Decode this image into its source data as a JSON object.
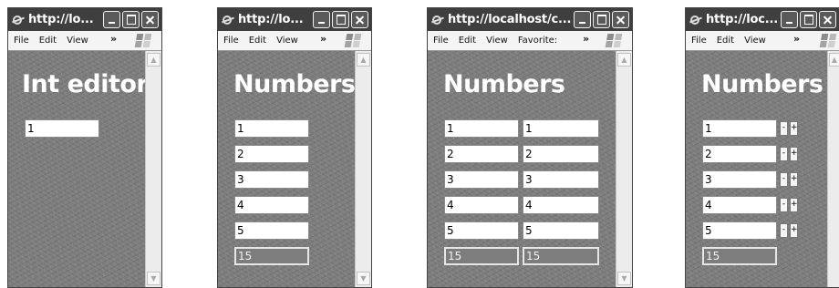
{
  "windows": [
    {
      "title": "http://lo...",
      "menu": [
        "File",
        "Edit",
        "View"
      ],
      "heading": "Int editor",
      "values": [
        "1"
      ]
    },
    {
      "title": "http://lo...",
      "menu": [
        "File",
        "Edit",
        "View"
      ],
      "heading": "Numbers",
      "values": [
        "1",
        "2",
        "3",
        "4",
        "5"
      ],
      "total": "15"
    },
    {
      "title": "http://localhost/c...",
      "menu": [
        "File",
        "Edit",
        "View",
        "Favorite:"
      ],
      "heading": "Numbers",
      "values": [
        "1",
        "2",
        "3",
        "4",
        "5"
      ],
      "values_b": [
        "1",
        "2",
        "3",
        "4",
        "5"
      ],
      "total": "15",
      "total_b": "15"
    },
    {
      "title": "http://loc...",
      "menu": [
        "File",
        "Edit",
        "View"
      ],
      "heading": "Numbers",
      "values": [
        "1",
        "2",
        "3",
        "4",
        "5"
      ],
      "total": "15",
      "decrement_label": "-",
      "increment_label": "+"
    }
  ],
  "chevron": "»"
}
